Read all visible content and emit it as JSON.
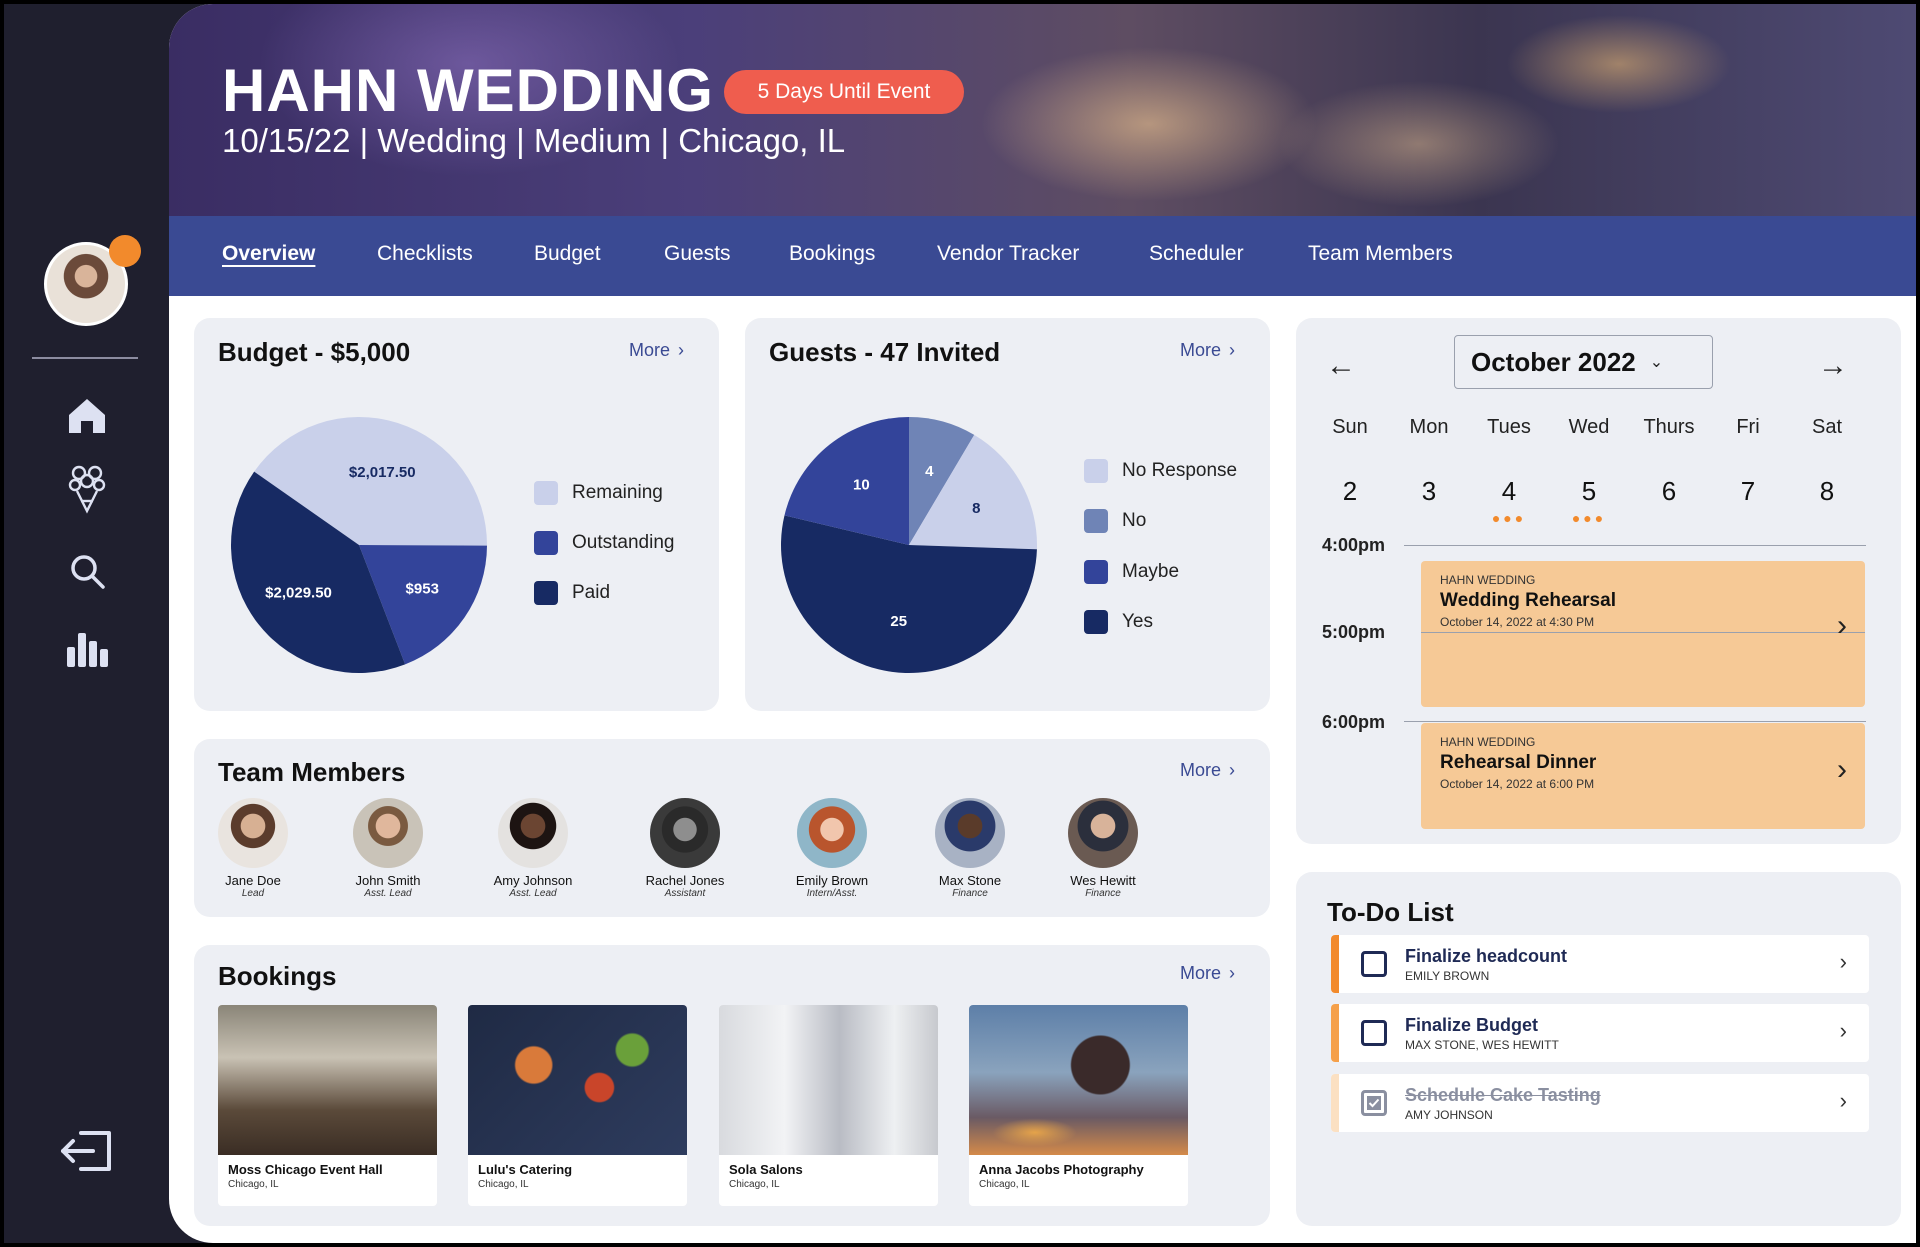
{
  "sidebar": {
    "avatar_alt": "",
    "icons": [
      "home-icon",
      "bouquet-icon",
      "search-icon",
      "analytics-icon",
      "logout-icon"
    ]
  },
  "hero": {
    "title": "HAHN WEDDING",
    "badge": "5 Days Until Event",
    "subtitle": "10/15/22 | Wedding | Medium | Chicago, IL"
  },
  "tabs": [
    "Overview",
    "Checklists",
    "Budget",
    "Guests",
    "Bookings",
    "Vendor Tracker",
    "Scheduler",
    "Team Members"
  ],
  "budget": {
    "title": "Budget - $5,000",
    "more": "More",
    "legend": [
      "Remaining",
      "Outstanding",
      "Paid"
    ],
    "slices": [
      {
        "label": "$2,017.50",
        "value": 2017.5,
        "color": "#c9d0ea"
      },
      {
        "label": "$953",
        "value": 953,
        "color": "#33449a"
      },
      {
        "label": "$2,029.50",
        "value": 2029.5,
        "color": "#172a63"
      }
    ]
  },
  "guests": {
    "title": "Guests - 47 Invited",
    "more": "More",
    "legend": [
      "No Response",
      "No",
      "Maybe",
      "Yes"
    ],
    "slices": [
      {
        "label": "4",
        "value": 4,
        "color": "#6f84b6"
      },
      {
        "label": "8",
        "value": 8,
        "color": "#c9d0ea"
      },
      {
        "label": "25",
        "value": 25,
        "color": "#172a63"
      },
      {
        "label": "10",
        "value": 10,
        "color": "#33449a"
      }
    ]
  },
  "team": {
    "title": "Team Members",
    "more": "More",
    "members": [
      {
        "name": "Jane Doe",
        "role": "Lead"
      },
      {
        "name": "John Smith",
        "role": "Asst. Lead"
      },
      {
        "name": "Amy Johnson",
        "role": "Asst. Lead"
      },
      {
        "name": "Rachel Jones",
        "role": "Assistant"
      },
      {
        "name": "Emily Brown",
        "role": "Intern/Asst."
      },
      {
        "name": "Max Stone",
        "role": "Finance"
      },
      {
        "name": "Wes Hewitt",
        "role": "Finance"
      }
    ]
  },
  "bookings": {
    "title": "Bookings",
    "more": "More",
    "items": [
      {
        "name": "Moss Chicago Event Hall",
        "location": "Chicago, IL"
      },
      {
        "name": "Lulu's Catering",
        "location": "Chicago, IL"
      },
      {
        "name": "Sola Salons",
        "location": "Chicago, IL"
      },
      {
        "name": "Anna Jacobs Photography",
        "location": "Chicago, IL"
      }
    ]
  },
  "calendar": {
    "month": "October 2022",
    "days": [
      "Sun",
      "Mon",
      "Tues",
      "Wed",
      "Thurs",
      "Fri",
      "Sat"
    ],
    "dates": [
      "2",
      "3",
      "4",
      "5",
      "6",
      "7",
      "8"
    ],
    "times": [
      "4:00pm",
      "5:00pm",
      "6:00pm"
    ],
    "events": [
      {
        "kicker": "HAHN WEDDING",
        "title": "Wedding Rehearsal",
        "when": "October 14, 2022 at 4:30 PM"
      },
      {
        "kicker": "HAHN WEDDING",
        "title": "Rehearsal Dinner",
        "when": "October 14, 2022 at 6:00 PM"
      }
    ]
  },
  "todo": {
    "title": "To-Do List",
    "items": [
      {
        "task": "Finalize headcount",
        "assignee": "EMILY BROWN",
        "done": false
      },
      {
        "task": "Finalize Budget",
        "assignee": "MAX STONE, WES HEWITT",
        "done": false
      },
      {
        "task": "Schedule Cake Tasting",
        "assignee": "AMY JOHNSON",
        "done": true
      }
    ]
  },
  "colors": {
    "accent": "#3a4a93",
    "orange": "#f28a2c",
    "badge": "#ef5d4e",
    "event": "#f6c996"
  }
}
